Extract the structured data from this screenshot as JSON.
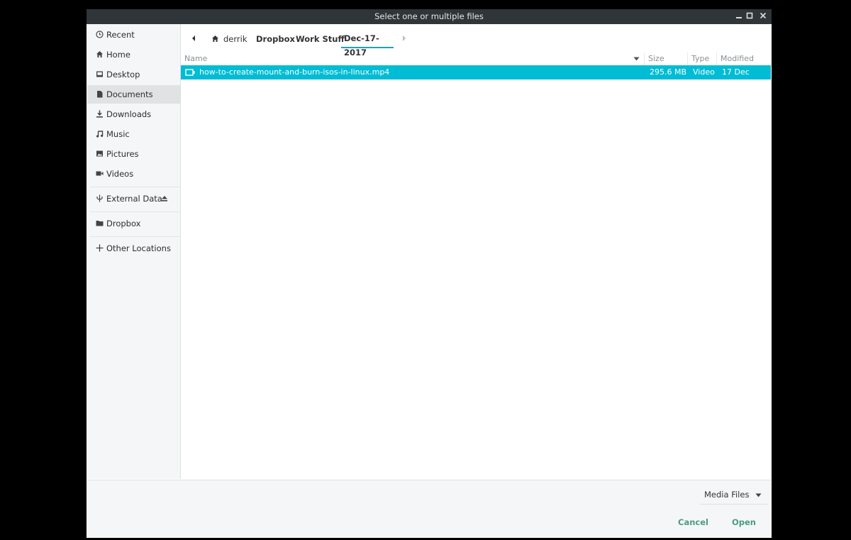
{
  "window": {
    "title": "Select one or multiple files",
    "controls": [
      "minimize-icon",
      "maximize-icon",
      "close-icon"
    ]
  },
  "sidebar": {
    "items": [
      {
        "label": "Recent",
        "icon": "clock-icon"
      },
      {
        "label": "Home",
        "icon": "home-icon"
      },
      {
        "label": "Desktop",
        "icon": "desktop-icon"
      },
      {
        "label": "Documents",
        "icon": "document-icon",
        "active": true
      },
      {
        "label": "Downloads",
        "icon": "download-icon"
      },
      {
        "label": "Music",
        "icon": "music-icon"
      },
      {
        "label": "Pictures",
        "icon": "picture-icon"
      },
      {
        "label": "Videos",
        "icon": "video-icon"
      },
      {
        "label": "External Data",
        "icon": "usb-icon",
        "eject": "eject-icon"
      },
      {
        "label": "Dropbox",
        "icon": "folder-icon"
      },
      {
        "label": "Other Locations",
        "icon": "plus-icon"
      }
    ]
  },
  "pathbar": {
    "segments": [
      "derrik",
      "Dropbox",
      "Work Stuff",
      "Dec-17-2017"
    ],
    "current": "Dec-17-2017"
  },
  "columns": {
    "name": "Name",
    "size": "Size",
    "type": "Type",
    "modified": "Modified"
  },
  "files": [
    {
      "name": "how-to-create-mount-and-burn-isos-in-linux.mp4",
      "size": "295.6 MB",
      "type": "Video",
      "modified": "17 Dec 2017",
      "selected": true
    }
  ],
  "footer": {
    "filter": "Media Files",
    "cancel": "Cancel",
    "open": "Open"
  },
  "colors": {
    "titlebar": "#2f3538",
    "selection": "#00bcd4",
    "accent": "#1ea0c8",
    "button_text": "#4a9b88"
  }
}
